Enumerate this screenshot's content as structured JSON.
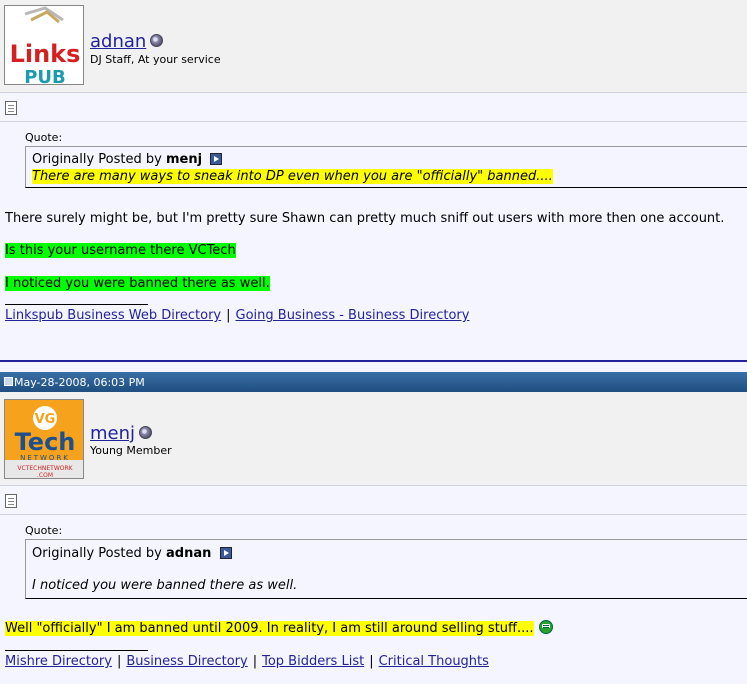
{
  "post1": {
    "username": "adnan",
    "user_title": "DJ Staff, At your service",
    "avatar_text": {
      "line1": "Links",
      "line2": "PUB"
    },
    "quote_label": "Quote:",
    "quote_prefix": "Originally Posted by",
    "quote_author": "menj",
    "quote_text": "There are many ways to sneak into DP even when you are \"officially\" banned....",
    "body": [
      "There surely might be, but I'm pretty sure Shawn can pretty much sniff out users with more then one account.",
      "Is this your username there VCTech",
      "I noticed you were banned there as well."
    ],
    "signature_links": [
      "Linkspub Business Web Directory",
      "Going Business - Business Directory"
    ],
    "separator": "|"
  },
  "post2": {
    "date": "May-28-2008, 06:03 PM",
    "username": "menj",
    "user_title": "Young Member",
    "avatar_text": {
      "top": "VG",
      "main": "Tech",
      "sub": "NETWORK",
      "url": "VCTECHNETWORK",
      "dotcom": ".COM"
    },
    "quote_label": "Quote:",
    "quote_prefix": "Originally Posted by",
    "quote_author": "adnan",
    "quote_text": "I noticed you were banned there as well.",
    "body": [
      "Well \"officially\" I am banned until 2009. In reality, I am still around selling stuff...."
    ],
    "signature_links": [
      "Mishre Directory",
      "Business Directory",
      "Top Bidders List",
      "Critical Thoughts"
    ],
    "separator": "|"
  },
  "colors": {
    "link": "#22229C",
    "highlight_yellow": "#FFFF00",
    "highlight_green": "#00FF00",
    "date_bar": "#2A5F94"
  }
}
